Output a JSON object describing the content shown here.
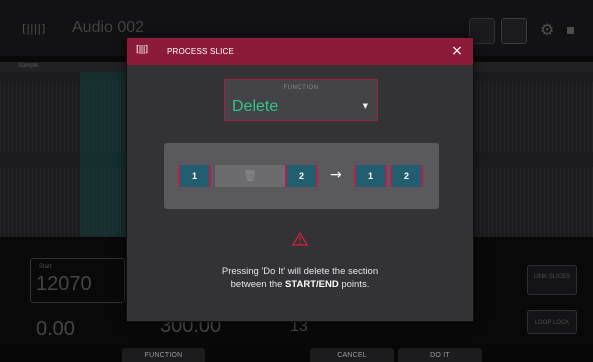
{
  "app": {
    "title": "Audio 002",
    "ruler_label": "Sample",
    "field_label": "Start",
    "values": {
      "start": "12070",
      "left": "0.00",
      "mid": "300.00",
      "right": "13"
    },
    "side_buttons": {
      "link_slices": "LINK SLICES",
      "loop_lock": "LOOP LOCK"
    }
  },
  "modal": {
    "title": "PROCESS SLICE",
    "close_glyph": "×",
    "function_label": "FUNCTION",
    "function_value": "Delete",
    "diagram": {
      "before": [
        "1",
        "2"
      ],
      "deleted_glyph": "🗑",
      "arrow": "→",
      "after": [
        "1",
        "2"
      ]
    },
    "warning_icon": "warning-icon",
    "message_pre": "Pressing 'Do It' will delete the section",
    "message_between": "between the ",
    "message_bold": "START/END",
    "message_post": " points."
  },
  "footer": {
    "function": "FUNCTION",
    "cancel": "CANCEL",
    "do_it": "DO IT"
  },
  "colors": {
    "accent": "#8c1b3a",
    "slice": "#225e70",
    "value": "#33c28a"
  }
}
